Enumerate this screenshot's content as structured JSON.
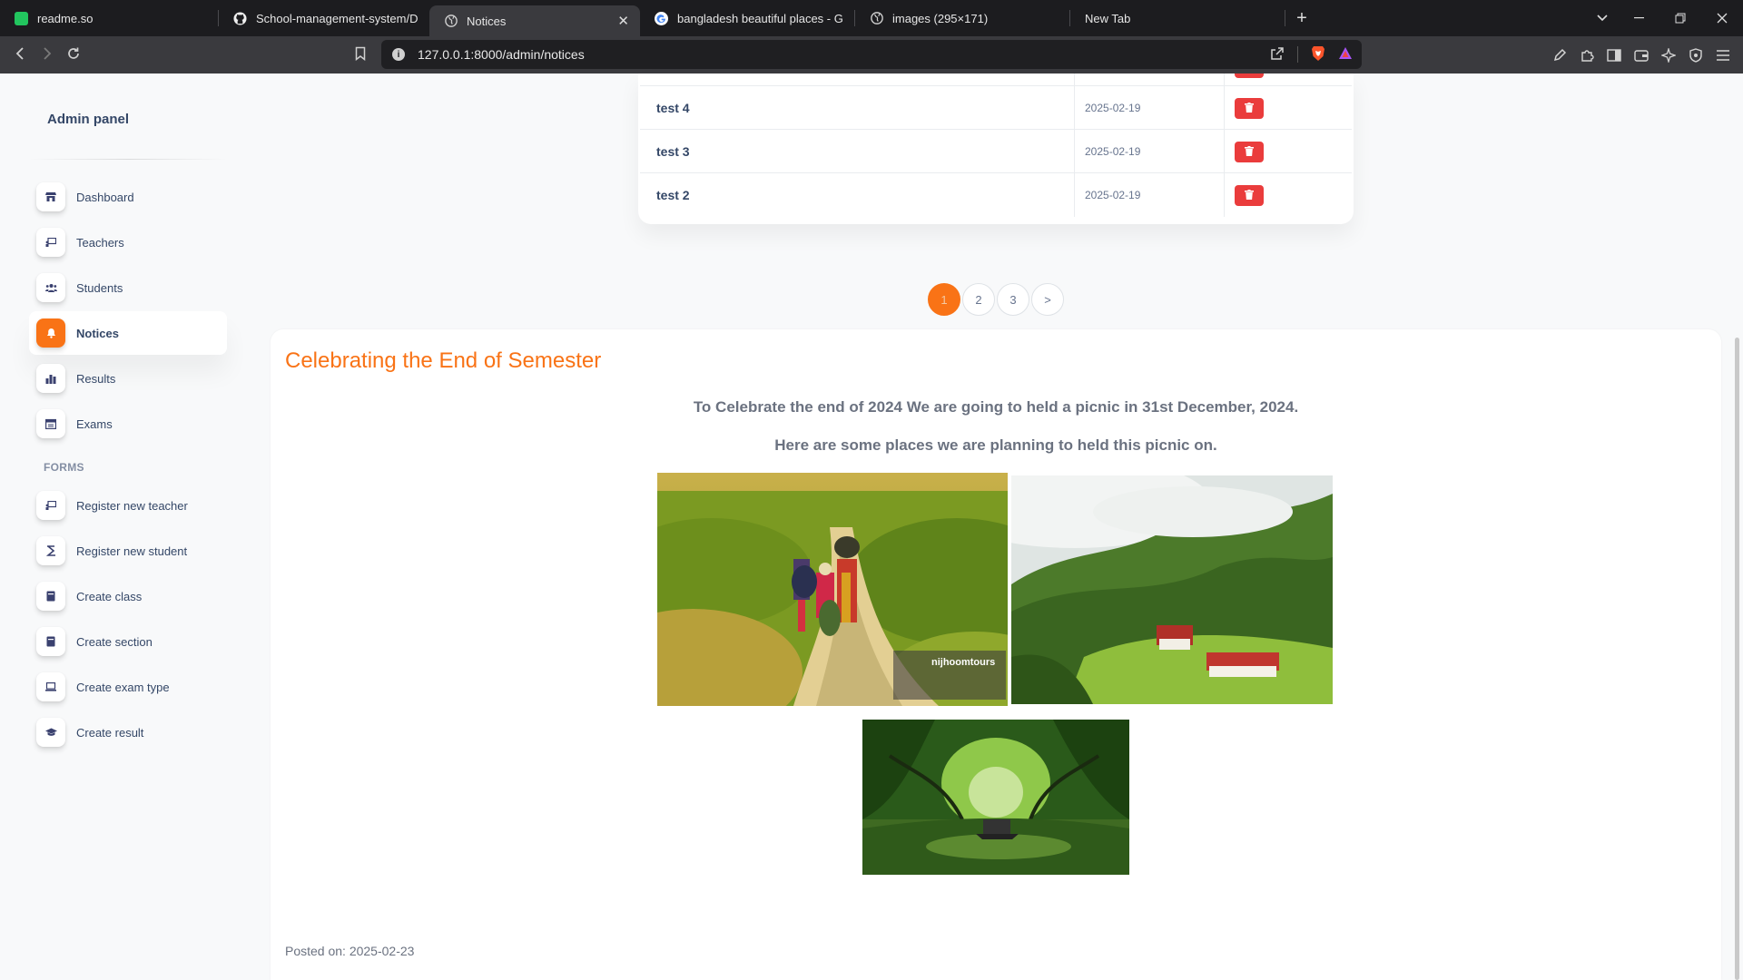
{
  "browser": {
    "tabs": [
      {
        "label": "readme.so",
        "icon": "readme-icon",
        "color": "#22c55e"
      },
      {
        "label": "School-management-system/Demo",
        "icon": "github-icon",
        "color": "#ffffff"
      },
      {
        "label": "Notices",
        "icon": "globe-icon",
        "color": "#cfcfcf",
        "active": true
      },
      {
        "label": "bangladesh beautiful places - Goog",
        "icon": "google-icon",
        "color": "#4285f4"
      },
      {
        "label": "images (295×171)",
        "icon": "globe-icon",
        "color": "#cfcfcf"
      },
      {
        "label": "New Tab",
        "icon": "",
        "color": ""
      }
    ],
    "close_glyph": "✕",
    "new_tab_glyph": "+",
    "url": "127.0.0.1:8000/admin/notices"
  },
  "sidebar": {
    "brand": "Admin panel",
    "items": [
      {
        "label": "Dashboard",
        "icon": "shop-icon"
      },
      {
        "label": "Teachers",
        "icon": "teacher-board-icon"
      },
      {
        "label": "Students",
        "icon": "users-icon"
      },
      {
        "label": "Notices",
        "icon": "bell-icon",
        "active": true
      },
      {
        "label": "Results",
        "icon": "bar-chart-icon"
      },
      {
        "label": "Exams",
        "icon": "calendar-icon"
      }
    ],
    "forms_title": "FORMS",
    "form_items": [
      {
        "label": "Register new teacher",
        "icon": "teacher-board-icon"
      },
      {
        "label": "Register new student",
        "icon": "student-icon"
      },
      {
        "label": "Create class",
        "icon": "book-icon"
      },
      {
        "label": "Create section",
        "icon": "book-icon"
      },
      {
        "label": "Create exam type",
        "icon": "laptop-icon"
      },
      {
        "label": "Create result",
        "icon": "graduation-cap-icon"
      }
    ]
  },
  "notices_table": {
    "rows": [
      {
        "title": "test 4",
        "date": "2025-02-19"
      },
      {
        "title": "test 3",
        "date": "2025-02-19"
      },
      {
        "title": "test 2",
        "date": "2025-02-19"
      }
    ]
  },
  "pagination": {
    "pages": [
      "1",
      "2",
      "3"
    ],
    "current": "1",
    "next": ">"
  },
  "notice": {
    "title": "Celebrating the End of Semester",
    "line1": "To Celebrate the end of 2024 We are going to held a picnic in 31st December, 2024.",
    "line2": "Here are some places we are planning to held this picnic on.",
    "watermark": "nijhoomtours",
    "posted": "Posted on: 2025-02-23"
  },
  "colors": {
    "accent": "#f97316",
    "danger": "#ea3c3c",
    "text": "#344767",
    "muted": "#67748e"
  }
}
